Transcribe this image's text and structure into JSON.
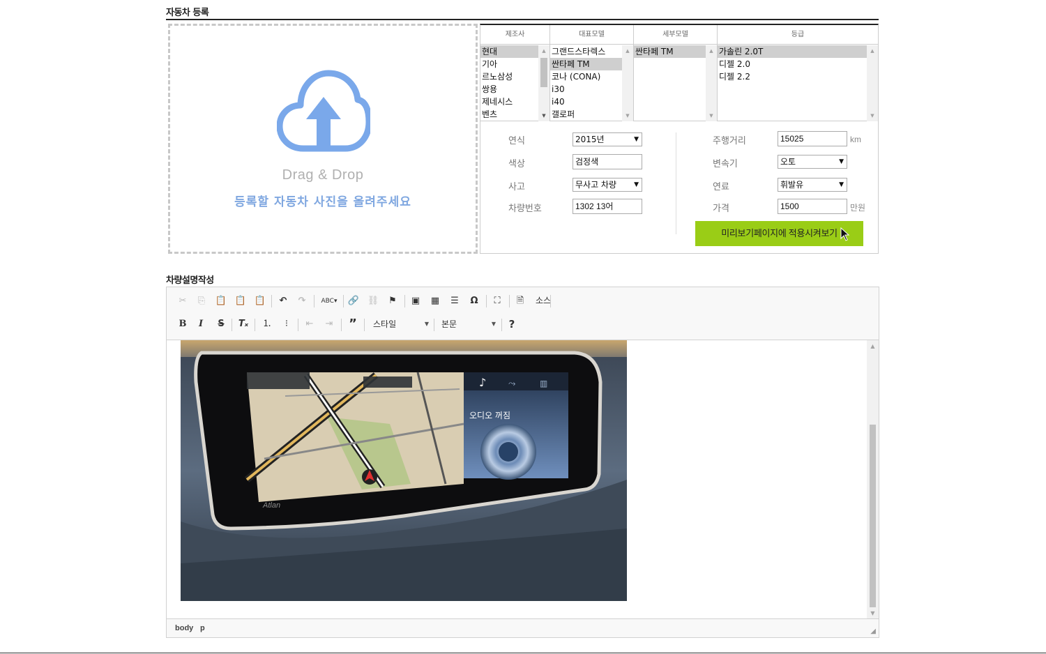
{
  "page": {
    "title": "자동차 등록",
    "description_title": "차량설명작성"
  },
  "upload": {
    "drag_text": "Drag & Drop",
    "hint": "등록할 자동차 사진을 올려주세요",
    "accent": "#7aa8ea"
  },
  "selector": {
    "columns": [
      {
        "header": "제조사",
        "items": [
          "현대",
          "기아",
          "르노삼성",
          "쌍용",
          "제네시스",
          "벤츠"
        ],
        "selected": 0
      },
      {
        "header": "대표모델",
        "items": [
          "그랜드스타렉스",
          "싼타페 TM",
          "코나 (CONA)",
          "i30",
          "i40",
          "갤로퍼"
        ],
        "selected": 1
      },
      {
        "header": "세부모델",
        "items": [
          "싼타페 TM"
        ],
        "selected": 0
      },
      {
        "header": "등급",
        "items": [
          "가솔린 2.0T",
          "디젤 2.0",
          "디젤 2.2"
        ],
        "selected": 0
      }
    ]
  },
  "form": {
    "year": {
      "label": "연식",
      "value": "2015년"
    },
    "color": {
      "label": "색상",
      "value": "검정색"
    },
    "accident": {
      "label": "사고",
      "value": "무사고 차량"
    },
    "plate": {
      "label": "차량번호",
      "value": "1302 13어"
    },
    "mileage": {
      "label": "주행거리",
      "value": "15025",
      "unit": "km"
    },
    "transmission": {
      "label": "변속기",
      "value": "오토"
    },
    "fuel": {
      "label": "연료",
      "value": "휘발유"
    },
    "price": {
      "label": "가격",
      "value": "1500",
      "unit": "만원"
    },
    "apply_button": "미리보기페이지에 적용시켜보기",
    "apply_color": "#9acd16"
  },
  "editor": {
    "source_label": "소스",
    "style_combo": "스타일",
    "format_combo": "본문",
    "help": "?",
    "status_path": [
      "body",
      "p"
    ],
    "photo_overlay_text": "오디오 꺼짐",
    "photo_brand": "Atlan"
  }
}
